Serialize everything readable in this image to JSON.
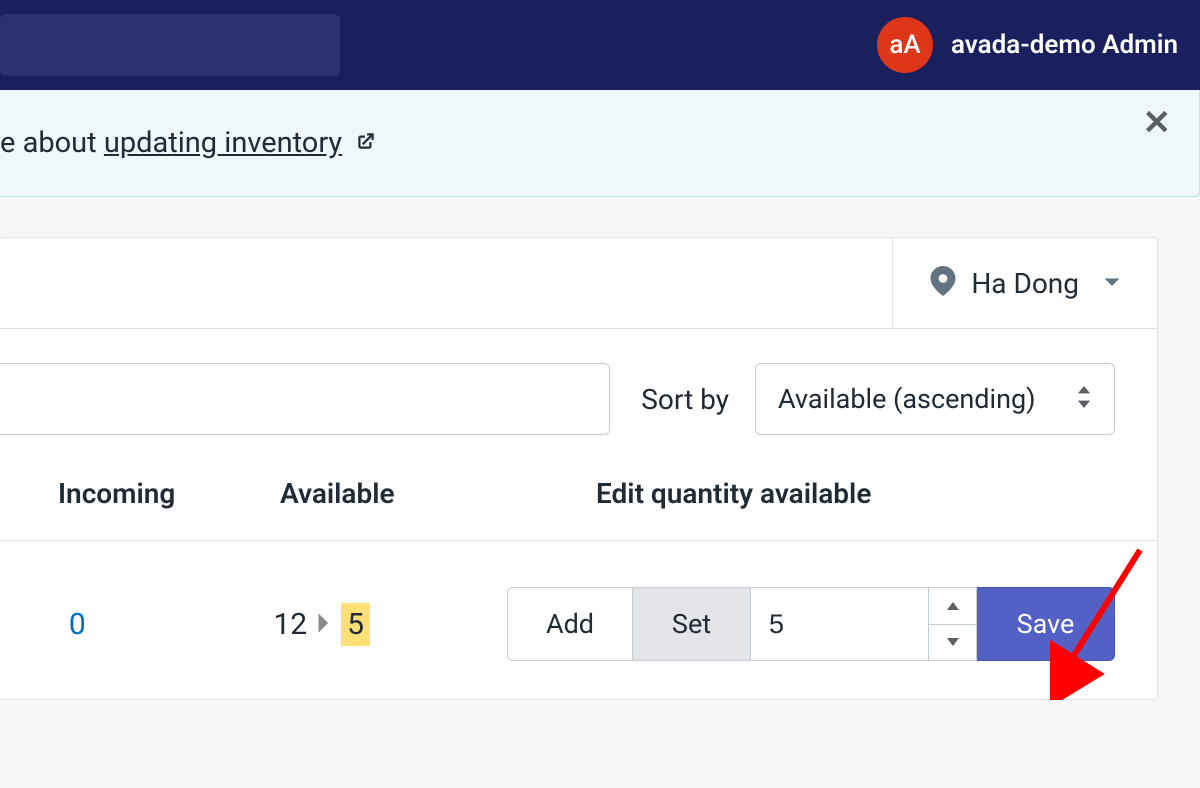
{
  "header": {
    "avatar_initials": "aA",
    "user_name": "avada-demo Admin"
  },
  "banner": {
    "text_prefix": "e about ",
    "link_text": "updating inventory"
  },
  "location": {
    "label": "Ha Dong"
  },
  "sort": {
    "label": "Sort by",
    "value": "Available (ascending)"
  },
  "columns": {
    "incoming": "Incoming",
    "available": "Available",
    "edit": "Edit quantity available"
  },
  "row": {
    "incoming": "0",
    "available_old": "12",
    "available_new": "5",
    "add_label": "Add",
    "set_label": "Set",
    "qty_value": "5",
    "save_label": "Save"
  }
}
